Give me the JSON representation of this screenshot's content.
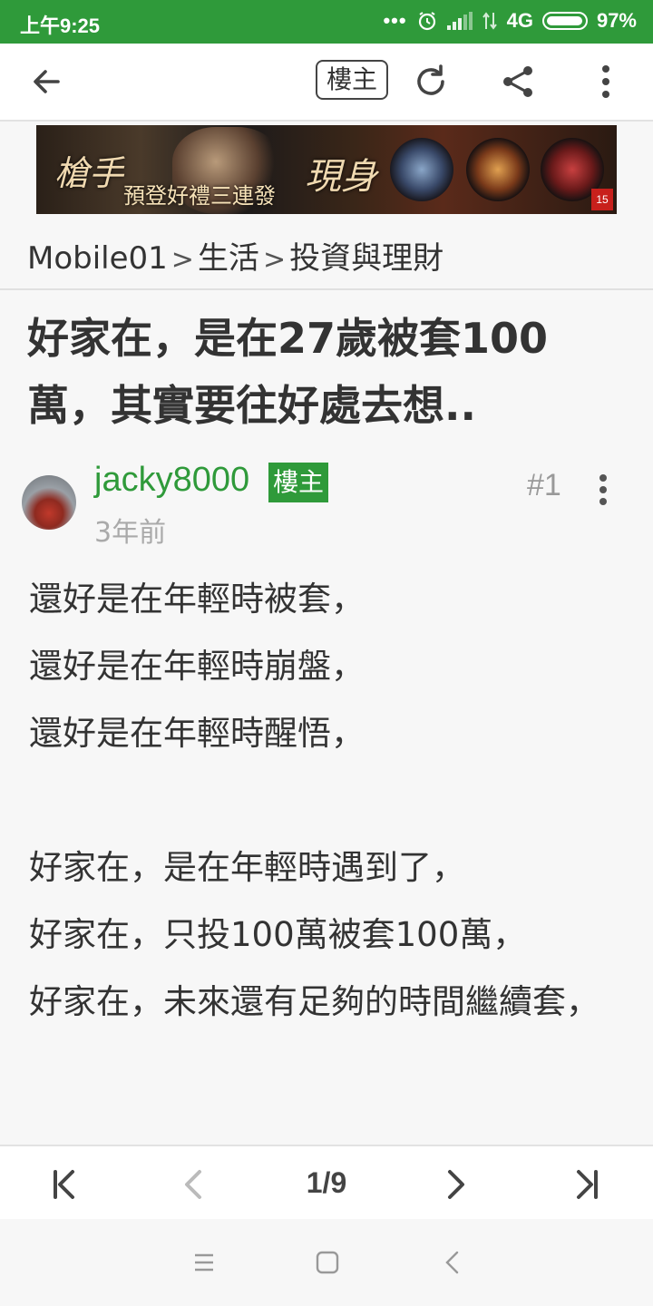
{
  "status_bar": {
    "time": "上午9:25",
    "network": "4G",
    "battery": "97%",
    "icons": [
      "more-dots-icon",
      "alarm-icon",
      "signal-icon",
      "data-transfer-icon",
      "battery-icon"
    ]
  },
  "toolbar": {
    "back_icon": "back-arrow-icon",
    "op_filter_label": "樓主",
    "refresh_icon": "refresh-icon",
    "share_icon": "share-icon",
    "more_icon": "more-vertical-icon"
  },
  "ad_banner": {
    "text_main": "槍手",
    "text_sub": "預登好禮三連發",
    "text_side": "現身",
    "rating": "15"
  },
  "breadcrumb": {
    "items": [
      "Mobile01",
      "生活",
      "投資與理財"
    ],
    "separator": ">"
  },
  "post": {
    "title": "好家在，是在27歲被套100萬，其實要往好處去想..",
    "author": "jacky8000",
    "author_tag": "樓主",
    "floor": "#1",
    "time_ago": "3年前",
    "content_lines": [
      "還好是在年輕時被套，",
      "還好是在年輕時崩盤，",
      "還好是在年輕時醒悟，",
      "",
      "好家在，是在年輕時遇到了，",
      "好家在，只投100萬被套100萬，",
      "好家在，未來還有足夠的時間繼續套，"
    ]
  },
  "pager": {
    "first_icon": "first-page-icon",
    "prev_icon": "prev-page-icon",
    "indicator": "1/9",
    "next_icon": "next-page-icon",
    "last_icon": "last-page-icon"
  },
  "colors": {
    "brand_green": "#2f9a3a",
    "text": "#333333",
    "muted": "#aaaaaa"
  }
}
